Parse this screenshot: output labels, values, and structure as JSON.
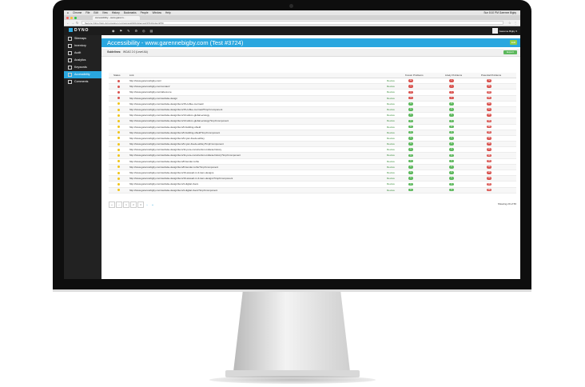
{
  "menubar": {
    "apple": "",
    "items": [
      "Chrome",
      "File",
      "Edit",
      "View",
      "History",
      "Bookmarks",
      "People",
      "Window",
      "Help"
    ],
    "right_text": "Sun 8:10 PM   Garenne Bigby"
  },
  "tab": {
    "title": "Accessibility - www.garenn..."
  },
  "address": {
    "url": "Secure  https://app.dynomapper.com/accessibility/sitemap/3724/index/2/50"
  },
  "app": {
    "logo": "DYNO",
    "top_icons": [
      "◉",
      "⚑",
      "✎",
      "⚙",
      "◎",
      "▤"
    ],
    "user": "Garenne Bigby ▾"
  },
  "sidebar": {
    "items": [
      {
        "label": "Sitemaps"
      },
      {
        "label": "Inventory"
      },
      {
        "label": "Audit"
      },
      {
        "label": "Analytics"
      },
      {
        "label": "Keywords"
      },
      {
        "label": "Accessibility"
      },
      {
        "label": "Comments"
      }
    ]
  },
  "page": {
    "title": "Accessibility - www.garennebigby.com (Test #3724)",
    "edit_label": "Edit",
    "guidelines_label": "Guidelines:",
    "guidelines_value": "WCAG 2.0 (Level AA)",
    "export_label": "Export"
  },
  "table": {
    "headers": {
      "status": "Status",
      "url": "Link",
      "review": "",
      "known": "Known Problems",
      "likely": "Likely Problems",
      "potential": "Potential Problems"
    },
    "rows": [
      {
        "status": "bad",
        "url": "http://www.garennebigby.com/",
        "review": "Review",
        "known": "11",
        "likely": "1",
        "potential": "72"
      },
      {
        "status": "bad",
        "url": "http://www.garennebigby.com/contact/",
        "review": "Review",
        "known": "3",
        "likely": "1",
        "potential": "56"
      },
      {
        "status": "bad",
        "url": "http://www.garennebigby.com/about-me",
        "review": "Review",
        "known": "3",
        "likely": "1",
        "potential": "60"
      },
      {
        "status": "bad",
        "url": "http://www.garennebigby.com/website-design",
        "review": "Review",
        "known": "4",
        "likely": "1",
        "potential": "66"
      },
      {
        "status": "warn",
        "url": "http://www.garennebigby.com/website-design/item/15-coffee-mermaid",
        "review": "Review",
        "known": "0",
        "likely": "0",
        "potential": "54"
      },
      {
        "status": "warn",
        "url": "http://www.garennebigby.com/website-design/item/15-coffee-mermaid?tmpl=component",
        "review": "Review",
        "known": "0",
        "likely": "0",
        "potential": "54"
      },
      {
        "status": "warn",
        "url": "http://www.garennebigby.com/website-design/item/13-wilcox-global-ecology",
        "review": "Review",
        "known": "0",
        "likely": "0",
        "potential": "58"
      },
      {
        "status": "warn",
        "url": "http://www.garennebigby.com/website-design/item/13-wilcox-global-ecology?tmpl=component",
        "review": "Review",
        "known": "0",
        "likely": "0",
        "potential": "58"
      },
      {
        "status": "warn",
        "url": "http://www.garennebigby.com/website-design/item/6-building-shield",
        "review": "Review",
        "known": "0",
        "likely": "0",
        "potential": "58"
      },
      {
        "status": "warn",
        "url": "http://www.garennebigby.com/website-design/item/6-building-shield?tmpl=component",
        "review": "Review",
        "known": "0",
        "likely": "0",
        "potential": "58"
      },
      {
        "status": "warn",
        "url": "http://www.garennebigby.com/website-design/item/9-ryan-freels-ashley",
        "review": "Review",
        "known": "0",
        "likely": "0",
        "potential": "58"
      },
      {
        "status": "warn",
        "url": "http://www.garennebigby.com/website-design/item/9-ryan-freels-ashley?tmpl=component",
        "review": "Review",
        "known": "0",
        "likely": "0",
        "potential": "58"
      },
      {
        "status": "warn",
        "url": "http://www.garennebigby.com/website-design/item/11-pure-construction-indiana-history",
        "review": "Review",
        "known": "0",
        "likely": "0",
        "potential": "56"
      },
      {
        "status": "warn",
        "url": "http://www.garennebigby.com/website-design/item/11-pure-construction-indiana-history?tmpl=component",
        "review": "Review",
        "known": "0",
        "likely": "0",
        "potential": "56"
      },
      {
        "status": "warn",
        "url": "http://www.garennebigby.com/website-design/item/8-bender-turbo",
        "review": "Review",
        "known": "0",
        "likely": "0",
        "potential": "58"
      },
      {
        "status": "warn",
        "url": "http://www.garennebigby.com/website-design/item/8-bender-turbo?tmpl=component",
        "review": "Review",
        "known": "0",
        "likely": "0",
        "potential": "58"
      },
      {
        "status": "warn",
        "url": "http://www.garennebigby.com/website-design/item/16-stewart-in-3-item-designs",
        "review": "Review",
        "known": "0",
        "likely": "0",
        "potential": "58"
      },
      {
        "status": "warn",
        "url": "http://www.garennebigby.com/website-design/item/16-stewart-in-3-item-designs?tmpl=component",
        "review": "Review",
        "known": "0",
        "likely": "0",
        "potential": "58"
      },
      {
        "status": "warn",
        "url": "http://www.garennebigby.com/website-design/item/4-digital-rivers",
        "review": "Review",
        "known": "0",
        "likely": "0",
        "potential": "58"
      },
      {
        "status": "warn",
        "url": "http://www.garennebigby.com/website-design/item/4-digital-rivers?tmpl=component",
        "review": "Review",
        "known": "0",
        "likely": "0",
        "potential": "58"
      }
    ]
  },
  "pager": {
    "buttons": [
      "«",
      "‹",
      "1",
      "2",
      "3",
      "›",
      "»"
    ],
    "showing": "Showing 20 of 56"
  },
  "colors": {
    "accent": "#2aa7df",
    "sidebar": "#222222",
    "danger": "#d9534f",
    "success": "#5cb85c",
    "warning": "#f0c419"
  }
}
